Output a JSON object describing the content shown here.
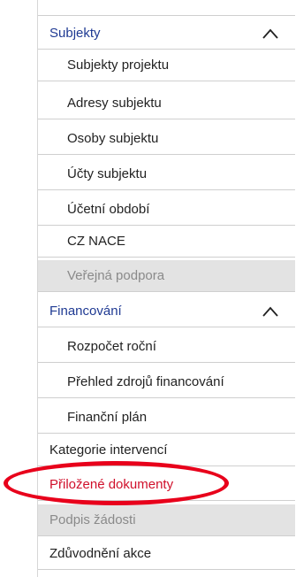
{
  "menu": {
    "subjekty": {
      "label": "Subjekty",
      "items": [
        {
          "label": "Subjekty projektu"
        },
        {
          "label": "Adresy subjektu"
        },
        {
          "label": "Osoby subjektu"
        },
        {
          "label": "Účty subjektu"
        },
        {
          "label": "Účetní období"
        },
        {
          "label": "CZ NACE"
        },
        {
          "label": "Veřejná podpora",
          "disabled": true
        }
      ]
    },
    "financovani": {
      "label": "Financování",
      "items": [
        {
          "label": "Rozpočet roční"
        },
        {
          "label": "Přehled zdrojů financování"
        },
        {
          "label": "Finanční plán"
        }
      ]
    },
    "top_items": [
      {
        "label": "Kategorie intervencí"
      },
      {
        "label": "Přiložené dokumenty",
        "highlighted": true
      },
      {
        "label": "Podpis žádosti",
        "disabled": true
      },
      {
        "label": "Zdůvodnění akce"
      }
    ]
  },
  "colors": {
    "section": "#1f3a93",
    "highlight": "#d0102b",
    "annotation_ring": "#e8001b",
    "disabled_bg": "#e3e3e3"
  }
}
